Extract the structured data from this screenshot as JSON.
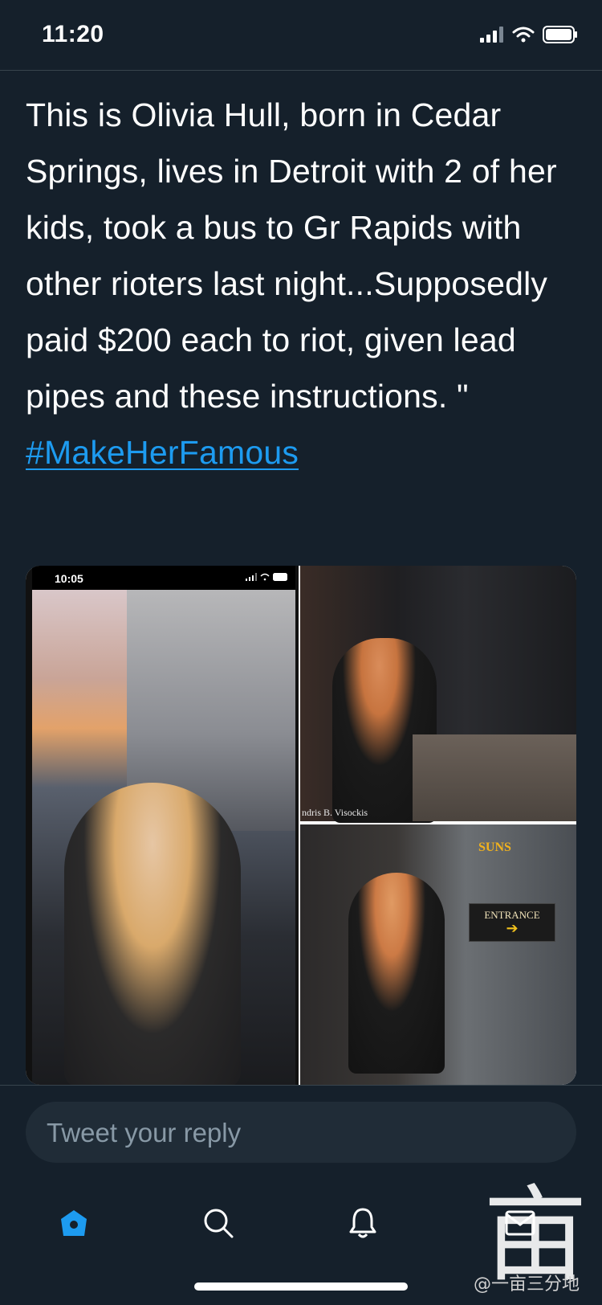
{
  "status_bar": {
    "time": "11:20"
  },
  "tweet": {
    "text": "This is Olivia Hull, born in Cedar Springs, lives in Detroit with 2 of her kids, took a bus to Gr Rapids with other rioters last night...Supposedly paid $200 each to riot, given lead pipes and these instructions. \"",
    "hashtag": "#MakeHerFamous"
  },
  "media": {
    "left_phone_time": "10:05",
    "photo_credit": "ndris B. Visockis",
    "sign_text": "ENTRANCE",
    "sign_logo_text": "SUNS"
  },
  "reply": {
    "placeholder": "Tweet your reply"
  },
  "tabbar": {
    "items": [
      "home-icon",
      "search-icon",
      "notifications-icon",
      "messages-icon"
    ]
  },
  "watermark": {
    "glyph": "亩",
    "text": "@一亩三分地"
  },
  "colors": {
    "background": "#15202b",
    "link": "#1d9bf0",
    "reply_bg": "#202c37",
    "placeholder": "#8899a6"
  }
}
